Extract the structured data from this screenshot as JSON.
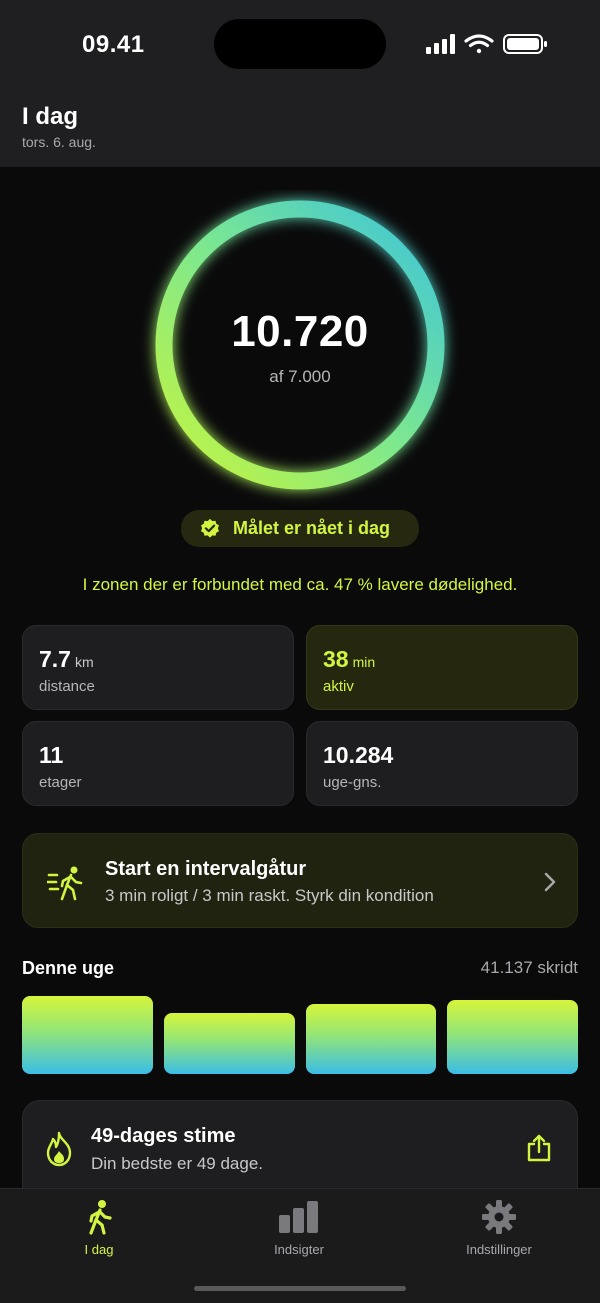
{
  "status_bar": {
    "time": "09.41",
    "icons": [
      "signal-icon",
      "wifi-icon",
      "battery-icon"
    ]
  },
  "header": {
    "title": "I dag",
    "date": "tors. 6. aug."
  },
  "progress_ring": {
    "steps": "10.720",
    "goal_text": "af 7.000",
    "progress_fraction": 1.0,
    "colors": [
      "#c8f53c",
      "#7de88f",
      "#3cc3dc"
    ]
  },
  "goal_badge": {
    "text": "Målet er nået i dag",
    "icon": "check-badge-icon"
  },
  "zone_text": "I zonen der er forbundet med ca. 47 % lavere dødelighed.",
  "stats": [
    {
      "value": "7.7",
      "unit": "km",
      "label": "distance",
      "highlight": false
    },
    {
      "value": "38",
      "unit": "min",
      "label": "aktiv",
      "highlight": true
    },
    {
      "value": "11",
      "unit": "",
      "label": "etager",
      "highlight": false
    },
    {
      "value": "10.284",
      "unit": "",
      "label": "uge-gns.",
      "highlight": false
    }
  ],
  "interval_card": {
    "title": "Start en intervalgåtur",
    "subtitle": "3 min roligt / 3 min raskt. Styrk din kondition",
    "icon": "walking-fast-icon"
  },
  "week": {
    "title": "Denne uge",
    "total": "41.137 skridt",
    "bars": [
      1.0,
      0.78,
      0.9,
      0.95
    ]
  },
  "streak_card": {
    "title": "49-dages stime",
    "subtitle": "Din bedste er 49 dage.",
    "icon": "flame-icon",
    "action_icon": "share-icon"
  },
  "tabs": [
    {
      "label": "I dag",
      "icon": "walking-icon",
      "active": true
    },
    {
      "label": "Indsigter",
      "icon": "bar-chart-icon",
      "active": false
    },
    {
      "label": "Indstillinger",
      "icon": "gear-icon",
      "active": false
    }
  ],
  "accent_color": "#d2f541"
}
